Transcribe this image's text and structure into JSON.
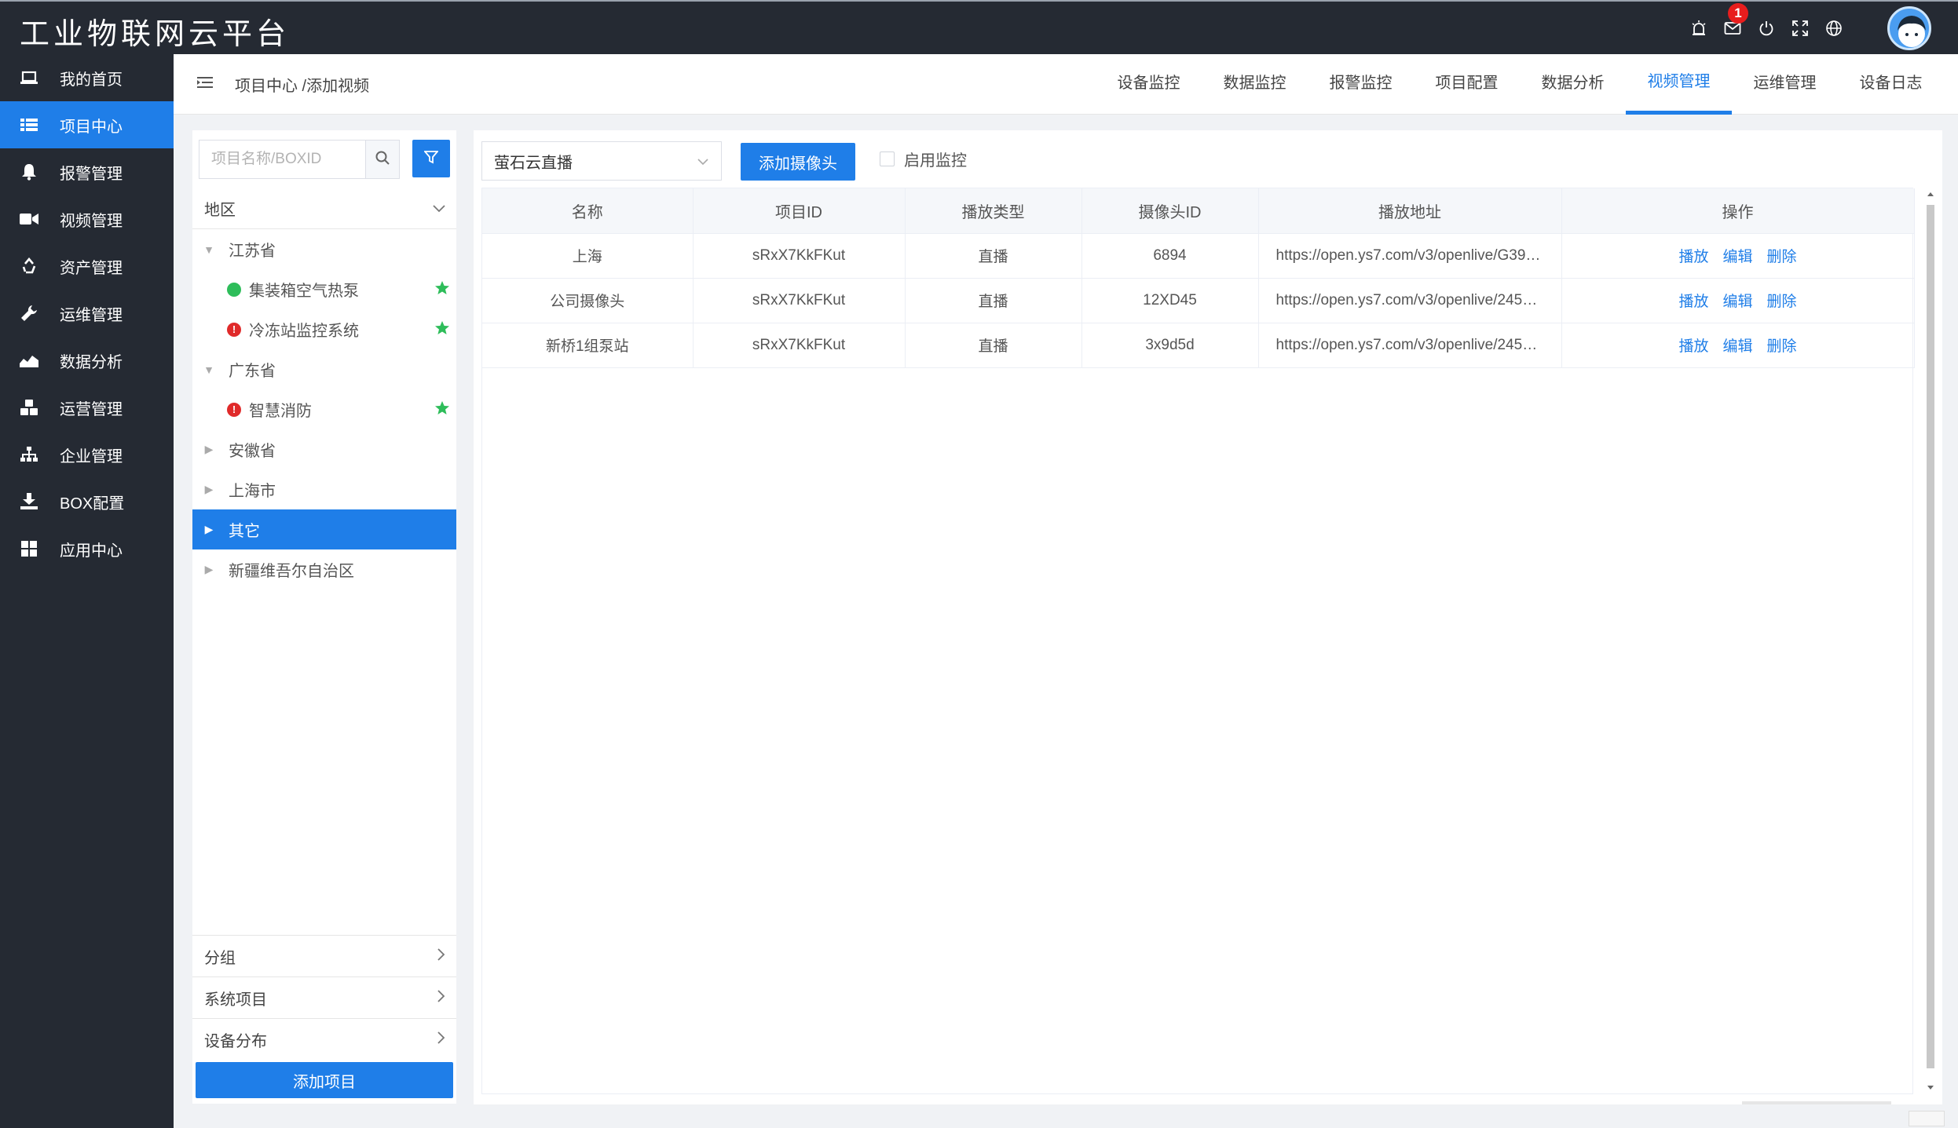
{
  "app": {
    "title": "工业物联网云平台",
    "notification_count": "1"
  },
  "top_icons": [
    "alarm-light-icon",
    "mail-icon",
    "power-icon",
    "fullscreen-icon",
    "globe-icon"
  ],
  "sidebar": {
    "items": [
      {
        "label": "我的首页",
        "icon": "laptop-icon",
        "active": false
      },
      {
        "label": "项目中心",
        "icon": "list-icon",
        "active": true
      },
      {
        "label": "报警管理",
        "icon": "bell-icon",
        "active": false
      },
      {
        "label": "视频管理",
        "icon": "video-camera-icon",
        "active": false
      },
      {
        "label": "资产管理",
        "icon": "recycle-icon",
        "active": false
      },
      {
        "label": "运维管理",
        "icon": "wrench-icon",
        "active": false
      },
      {
        "label": "数据分析",
        "icon": "area-chart-icon",
        "active": false
      },
      {
        "label": "运营管理",
        "icon": "cubes-icon",
        "active": false
      },
      {
        "label": "企业管理",
        "icon": "sitemap-icon",
        "active": false
      },
      {
        "label": "BOX配置",
        "icon": "download-icon",
        "active": false
      },
      {
        "label": "应用中心",
        "icon": "grid-icon",
        "active": false
      }
    ]
  },
  "header": {
    "breadcrumb": "项目中心 /添加视频",
    "tabs": [
      {
        "label": "设备监控",
        "active": false
      },
      {
        "label": "数据监控",
        "active": false
      },
      {
        "label": "报警监控",
        "active": false
      },
      {
        "label": "项目配置",
        "active": false
      },
      {
        "label": "数据分析",
        "active": false
      },
      {
        "label": "视频管理",
        "active": true
      },
      {
        "label": "运维管理",
        "active": false
      },
      {
        "label": "设备日志",
        "active": false
      }
    ]
  },
  "left_panel": {
    "search_placeholder": "项目名称/BOXID",
    "region_label": "地区",
    "tree": [
      {
        "label": "江苏省",
        "level": 0,
        "expanded": true
      },
      {
        "label": "集装箱空气热泵",
        "level": 1,
        "status": "green",
        "starred": true
      },
      {
        "label": "冷冻站监控系统",
        "level": 1,
        "status": "red",
        "starred": true
      },
      {
        "label": "广东省",
        "level": 0,
        "expanded": true
      },
      {
        "label": "智慧消防",
        "level": 1,
        "status": "red",
        "starred": true
      },
      {
        "label": "安徽省",
        "level": 0,
        "expanded": false
      },
      {
        "label": "上海市",
        "level": 0,
        "expanded": false
      },
      {
        "label": "其它",
        "level": 0,
        "expanded": false,
        "selected": true
      },
      {
        "label": "新疆维吾尔自治区",
        "level": 0,
        "expanded": false
      }
    ],
    "group_label": "分组",
    "system_projects_label": "系统项目",
    "device_distribution_label": "设备分布",
    "add_project_label": "添加项目"
  },
  "main": {
    "source_select": "萤石云直播",
    "add_camera_label": "添加摄像头",
    "enable_monitor_label": "启用监控",
    "table": {
      "columns": [
        "名称",
        "项目ID",
        "播放类型",
        "摄像头ID",
        "播放地址",
        "操作"
      ],
      "rows": [
        {
          "name": "上海",
          "project_id": "sRxX7KkFKut",
          "play_type": "直播",
          "camera_id": "6894",
          "url": "https://open.ys7.com/v3/openlive/G39…"
        },
        {
          "name": "公司摄像头",
          "project_id": "sRxX7KkFKut",
          "play_type": "直播",
          "camera_id": "12XD45",
          "url": "https://open.ys7.com/v3/openlive/245…"
        },
        {
          "name": "新桥1组泵站",
          "project_id": "sRxX7KkFKut",
          "play_type": "直播",
          "camera_id": "3x9d5d",
          "url": "https://open.ys7.com/v3/openlive/245…"
        }
      ],
      "actions": {
        "play": "播放",
        "edit": "编辑",
        "delete": "删除"
      }
    }
  }
}
